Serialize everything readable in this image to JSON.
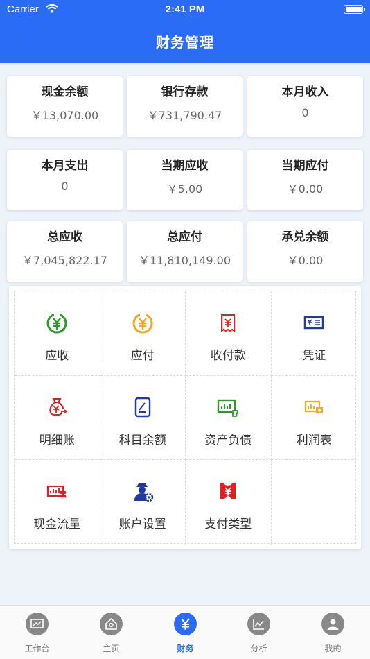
{
  "status": {
    "carrier": "Carrier",
    "time": "2:41 PM"
  },
  "header": {
    "title": "财务管理"
  },
  "stats": [
    {
      "label": "现金余额",
      "value": "￥13,070.00"
    },
    {
      "label": "银行存款",
      "value": "￥731,790.47"
    },
    {
      "label": "本月收入",
      "value": "0"
    },
    {
      "label": "本月支出",
      "value": "0"
    },
    {
      "label": "当期应收",
      "value": "￥5.00"
    },
    {
      "label": "当期应付",
      "value": "￥0.00"
    },
    {
      "label": "总应收",
      "value": "￥7,045,822.17"
    },
    {
      "label": "总应付",
      "value": "￥11,810,149.00"
    },
    {
      "label": "承兑余额",
      "value": "￥0.00"
    }
  ],
  "menu": [
    {
      "label": "应收",
      "icon": "receivable-icon",
      "color": "#2a9a2a"
    },
    {
      "label": "应付",
      "icon": "payable-icon",
      "color": "#f5a623"
    },
    {
      "label": "收付款",
      "icon": "receipt-icon",
      "color": "#e02020"
    },
    {
      "label": "凭证",
      "icon": "voucher-icon",
      "color": "#1e3aa8"
    },
    {
      "label": "明细账",
      "icon": "money-bag-icon",
      "color": "#e02020"
    },
    {
      "label": "科目余额",
      "icon": "document-icon",
      "color": "#1e3aa8"
    },
    {
      "label": "资产负债",
      "icon": "balance-sheet-icon",
      "color": "#2a9a2a"
    },
    {
      "label": "利润表",
      "icon": "profit-chart-icon",
      "color": "#f5a623"
    },
    {
      "label": "现金流量",
      "icon": "cash-flow-icon",
      "color": "#e02020"
    },
    {
      "label": "账户设置",
      "icon": "account-settings-icon",
      "color": "#1e3aa8"
    },
    {
      "label": "支付类型",
      "icon": "payment-type-icon",
      "color": "#e02020"
    }
  ],
  "tabs": [
    {
      "label": "工作台",
      "icon": "dashboard-icon"
    },
    {
      "label": "主页",
      "icon": "home-icon"
    },
    {
      "label": "财务",
      "icon": "yuan-icon",
      "active": true
    },
    {
      "label": "分析",
      "icon": "chart-icon"
    },
    {
      "label": "我的",
      "icon": "profile-icon"
    }
  ],
  "colors": {
    "primary": "#2a6cf6",
    "background": "#eef2f9"
  }
}
